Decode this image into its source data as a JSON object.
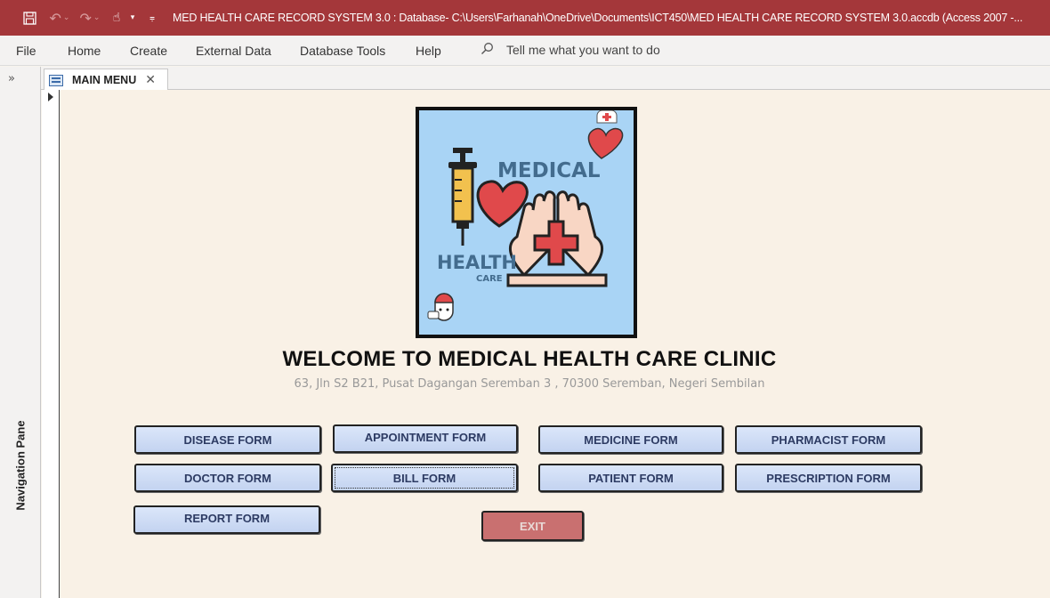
{
  "window": {
    "title": "MED HEALTH CARE RECORD SYSTEM 3.0 : Database- C:\\Users\\Farhanah\\OneDrive\\Documents\\ICT450\\MED HEALTH CARE RECORD SYSTEM 3.0.accdb (Access 2007 -..."
  },
  "ribbon": {
    "tabs": [
      "File",
      "Home",
      "Create",
      "External Data",
      "Database Tools",
      "Help"
    ],
    "tell_me": "Tell me what you want to do"
  },
  "nav_pane": {
    "label": "Navigation Pane",
    "toggle": "»"
  },
  "doc_tab": {
    "label": "MAIN MENU"
  },
  "logo": {
    "text_top": "MEDICAL",
    "text_mid": "HEALTH",
    "text_bottom": "CARE"
  },
  "main": {
    "welcome": "WELCOME TO MEDICAL HEALTH CARE CLINIC",
    "address": "63, Jln S2 B21, Pusat Dagangan Seremban 3 , 70300 Seremban, Negeri Sembilan"
  },
  "buttons": {
    "disease": "DISEASE FORM",
    "appointment": "APPOINTMENT FORM",
    "medicine": "MEDICINE FORM",
    "pharmacist": "PHARMACIST FORM",
    "doctor": "DOCTOR FORM",
    "bill": "BILL FORM",
    "patient": "PATIENT FORM",
    "prescription": "PRESCRIPTION FORM",
    "report": "REPORT FORM",
    "exit": "EXIT"
  },
  "colors": {
    "titlebar": "#a4373a",
    "form_button": "#c3d3f0",
    "exit_button": "#c97070",
    "canvas": "#f9f1e6",
    "logo_bg": "#a9d4f5"
  }
}
